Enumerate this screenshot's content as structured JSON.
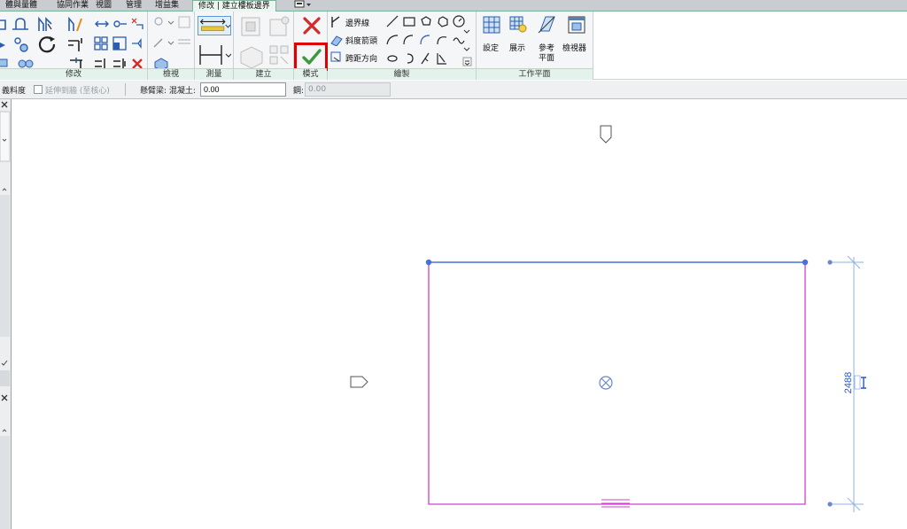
{
  "tabs": [
    {
      "label": "體與量體"
    },
    {
      "label": "協同作業"
    },
    {
      "label": "視圖"
    },
    {
      "label": "管理"
    },
    {
      "label": "增益集"
    },
    {
      "label": "修改 | 建立樓板邊界",
      "active": true
    }
  ],
  "ribbon": {
    "panels": {
      "modify": "修改",
      "view": "檢視",
      "measure": "測量",
      "create": "建立",
      "mode": "模式",
      "draw": "繪製",
      "workplane": "工作平面"
    },
    "draw_tools": {
      "boundary_line": "邊界線",
      "slope_arrow": "斜度箭頭",
      "span_direction": "跨距方向"
    },
    "workplane_tools": {
      "set": "設定",
      "show": "展示",
      "ref_plane_1": "參考",
      "ref_plane_2": "平面",
      "viewer": "檢視器"
    }
  },
  "options_bar": {
    "truncated_label": "義料度",
    "extend_checkbox_label": "延伸到牆 (至核心)",
    "extend_checked": false,
    "cantilever_label": "懸臂梁: 混凝土:",
    "concrete_value": "0.00",
    "steel_label": "鋼:",
    "steel_value": "0.00"
  },
  "canvas": {
    "dimension_value": "2488"
  },
  "colors": {
    "accent_green": "#3c9a3c",
    "cancel_red": "#d62a2a",
    "highlight_frame": "#e00000",
    "boundary_magenta": "#d040d0",
    "selected_blue": "#4a6fd8",
    "dimension_blue": "#2b55c0"
  }
}
